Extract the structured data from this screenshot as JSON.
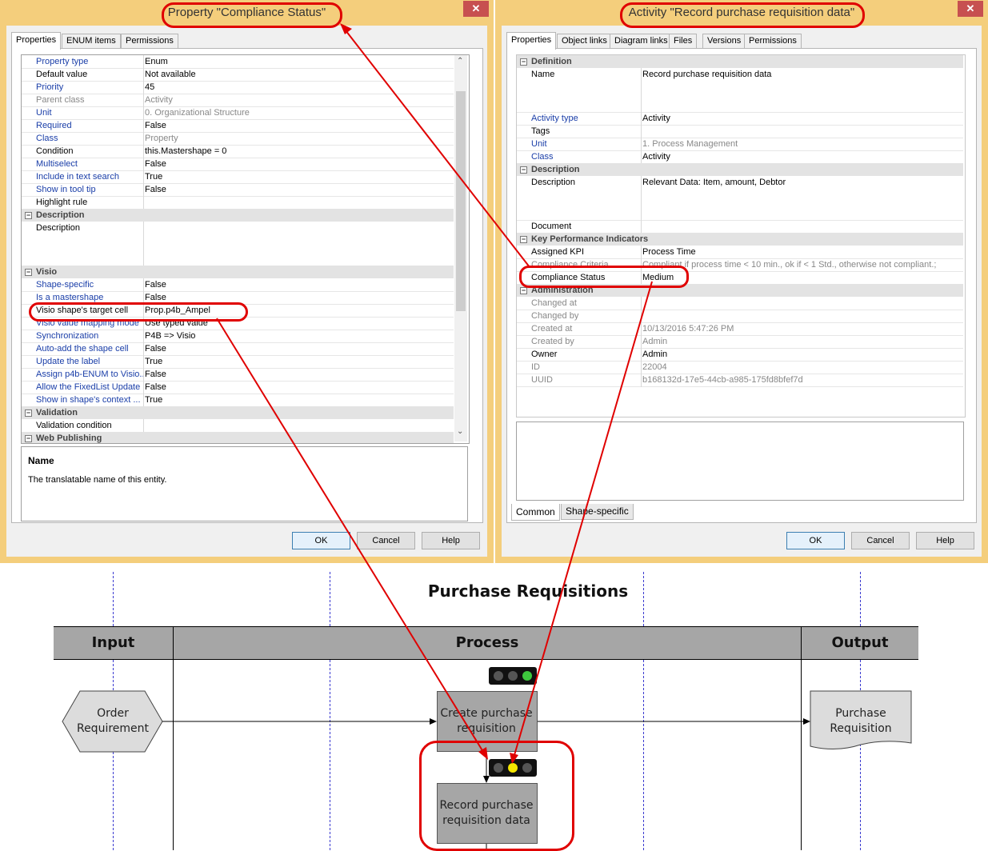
{
  "left_dialog": {
    "title": "Property \"Compliance Status\"",
    "close": "✕",
    "tabs": [
      "Properties",
      "ENUM items",
      "Permissions"
    ],
    "rows": [
      {
        "type": "row",
        "key": "Property type",
        "value": "Enum",
        "key_link": true
      },
      {
        "type": "row",
        "key": "Default value",
        "value": "Not available"
      },
      {
        "type": "row",
        "key": "Priority",
        "value": "45",
        "key_link": true
      },
      {
        "type": "row",
        "key": "Parent class",
        "value": "Activity",
        "dim": true
      },
      {
        "type": "row",
        "key": "Unit",
        "value": "0. Organizational Structure",
        "key_link": true,
        "dim_value": true
      },
      {
        "type": "row",
        "key": "Required",
        "value": "False",
        "key_link": true
      },
      {
        "type": "row",
        "key": "Class",
        "value": "Property",
        "key_link": true,
        "dim_value": true
      },
      {
        "type": "row",
        "key": "Condition",
        "value": "this.Mastershape = 0"
      },
      {
        "type": "row",
        "key": "Multiselect",
        "value": "False",
        "key_link": true
      },
      {
        "type": "row",
        "key": "Include in text search",
        "value": "True",
        "key_link": true
      },
      {
        "type": "row",
        "key": "Show in tool tip",
        "value": "False",
        "key_link": true
      },
      {
        "type": "row",
        "key": "Highlight rule",
        "value": ""
      },
      {
        "type": "cat",
        "label": "Description"
      },
      {
        "type": "row",
        "key": "Description",
        "value": "",
        "tall": true
      },
      {
        "type": "cat",
        "label": "Visio"
      },
      {
        "type": "row",
        "key": "Shape-specific",
        "value": "False",
        "key_link": true
      },
      {
        "type": "row",
        "key": "Is a mastershape",
        "value": "False",
        "key_link": true
      },
      {
        "type": "row",
        "key": "Visio shape's target cell",
        "value": "Prop.p4b_Ampel"
      },
      {
        "type": "row",
        "key": "Visio value mapping mode",
        "value": "Use typed value",
        "key_link": true
      },
      {
        "type": "row",
        "key": "Synchronization",
        "value": "P4B => Visio",
        "key_link": true
      },
      {
        "type": "row",
        "key": "Auto-add the shape cell",
        "value": "False",
        "key_link": true
      },
      {
        "type": "row",
        "key": "Update the label",
        "value": "True",
        "key_link": true
      },
      {
        "type": "row",
        "key": "Assign p4b-ENUM to Visio...",
        "value": "False",
        "key_link": true
      },
      {
        "type": "row",
        "key": "Allow the FixedList Update",
        "value": "False",
        "key_link": true
      },
      {
        "type": "row",
        "key": "Show in shape's context ...",
        "value": "True",
        "key_link": true
      },
      {
        "type": "cat",
        "label": "Validation"
      },
      {
        "type": "row",
        "key": "Validation condition",
        "value": ""
      },
      {
        "type": "cat",
        "label": "Web Publishing"
      }
    ],
    "help_title": "Name",
    "help_text": "The translatable name of this entity.",
    "buttons": [
      "OK",
      "Cancel",
      "Help"
    ]
  },
  "right_dialog": {
    "title": "Activity \"Record purchase requisition data\"",
    "close": "✕",
    "tabs": [
      "Properties",
      "Object links",
      "Diagram links",
      "Files",
      "Versions",
      "Permissions"
    ],
    "rows": [
      {
        "type": "cat",
        "label": "Definition"
      },
      {
        "type": "row",
        "key": "Name",
        "value": "Record purchase requisition data",
        "tall": true
      },
      {
        "type": "row",
        "key": "Activity type",
        "value": "Activity",
        "key_link": true
      },
      {
        "type": "row",
        "key": "Tags",
        "value": ""
      },
      {
        "type": "row",
        "key": "Unit",
        "value": "1. Process Management",
        "key_link": true,
        "dim_value": true
      },
      {
        "type": "row",
        "key": "Class",
        "value": "Activity",
        "key_link": true
      },
      {
        "type": "cat",
        "label": "Description"
      },
      {
        "type": "row",
        "key": "Description",
        "value": "Relevant Data: Item, amount, Debtor",
        "tall": true
      },
      {
        "type": "row",
        "key": "Document",
        "value": ""
      },
      {
        "type": "cat",
        "label": "Key Performance Indicators"
      },
      {
        "type": "row",
        "key": "Assigned KPI",
        "value": "Process Time"
      },
      {
        "type": "row",
        "key": "Compliance Criteria",
        "value": "Compliant if process time < 10 min., ok if < 1 Std., otherwise not compliant.;",
        "dim": true
      },
      {
        "type": "row",
        "key": "Compliance Status",
        "value": "Medium"
      },
      {
        "type": "cat",
        "label": "Administration"
      },
      {
        "type": "row",
        "key": "Changed at",
        "value": "",
        "dim": true
      },
      {
        "type": "row",
        "key": "Changed by",
        "value": "",
        "dim": true
      },
      {
        "type": "row",
        "key": "Created at",
        "value": "10/13/2016 5:47:26 PM",
        "dim": true
      },
      {
        "type": "row",
        "key": "Created by",
        "value": "Admin",
        "dim": true
      },
      {
        "type": "row",
        "key": "Owner",
        "value": "Admin"
      },
      {
        "type": "row",
        "key": "ID",
        "value": "22004",
        "dim": true
      },
      {
        "type": "row",
        "key": "UUID",
        "value": "b168132d-17e5-44cb-a985-175fd8bfef7d",
        "dim": true
      }
    ],
    "bottom_tabs": [
      "Common",
      "Shape-specific"
    ],
    "buttons": [
      "OK",
      "Cancel",
      "Help"
    ]
  },
  "diagram": {
    "title": "Purchase Requisitions",
    "lanes": [
      "Input",
      "Process",
      "Output"
    ],
    "shapes": {
      "order": [
        "Order",
        "Requirement"
      ],
      "create": [
        "Create purchase",
        "requisition"
      ],
      "record": [
        "Record purchase",
        "requisition data"
      ],
      "output": [
        "Purchase",
        "Requisition"
      ]
    },
    "traffic_lights": [
      {
        "id": "create",
        "active": "green"
      },
      {
        "id": "record",
        "active": "yellow"
      }
    ],
    "colors": {
      "green": "#3ec83e",
      "yellow": "#f5e600",
      "highlight": "#e00000",
      "lane": "#a6a6a6"
    }
  }
}
